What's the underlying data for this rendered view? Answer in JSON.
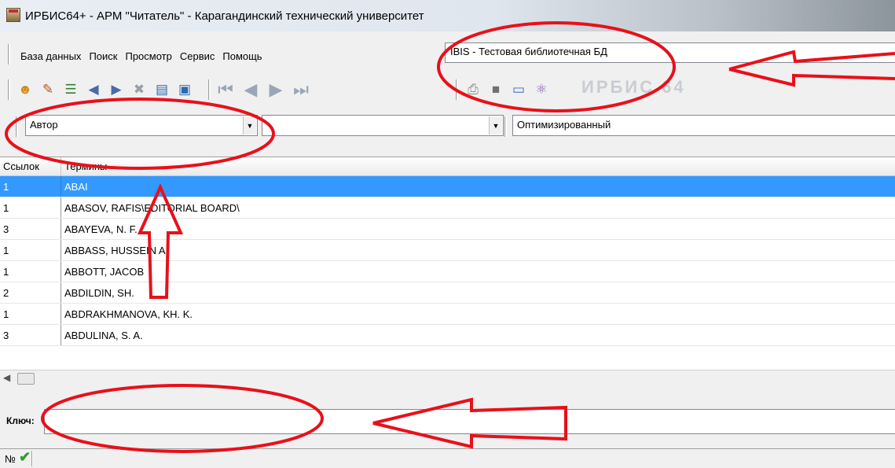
{
  "window": {
    "title": "ИРБИС64+ - АРМ \"Читатель\" - Карагандинский технический университет"
  },
  "menu": {
    "items": [
      "База данных",
      "Поиск",
      "Просмотр",
      "Сервис",
      "Помощь"
    ]
  },
  "database": {
    "selected": "IBIS - Тестовая библиотечная БД"
  },
  "toolbar": {
    "icons": [
      "users-icon",
      "book-edit-icon",
      "tree-icon",
      "search-left-icon",
      "search-right-icon",
      "close-list-icon",
      "doc-prev-icon",
      "doc-next-icon"
    ],
    "nav_icons": [
      "first-icon",
      "prev-icon",
      "next-icon",
      "last-icon"
    ],
    "right_icons": [
      "print-icon",
      "save-icon",
      "export-icon",
      "broom-icon"
    ],
    "banner_text": "ИРБИС 64"
  },
  "search": {
    "field": "Автор",
    "value": "",
    "mode": "Оптимизированный"
  },
  "grid": {
    "columns": [
      "Ссылок",
      "Термины"
    ],
    "rows": [
      {
        "count": "1",
        "term": "ABAI"
      },
      {
        "count": "1",
        "term": "ABASOV, RAFIS\\EDITORIAL BOARD\\"
      },
      {
        "count": "3",
        "term": "ABAYEVA, N. F."
      },
      {
        "count": "1",
        "term": "ABBASS, HUSSEIN A."
      },
      {
        "count": "1",
        "term": "ABBOTT, JACOB"
      },
      {
        "count": "2",
        "term": "ABDILDIN, SH."
      },
      {
        "count": "1",
        "term": "ABDRAKHMANOVA, KH. K."
      },
      {
        "count": "3",
        "term": "ABDULINA, S. A."
      }
    ],
    "selected_index": 0
  },
  "key": {
    "label": "Ключ:",
    "value": ""
  },
  "status": {
    "number_label": "№"
  },
  "colors": {
    "selection": "#3399ff",
    "annotation": "#e8101a",
    "status_ok": "#2aa02a"
  }
}
